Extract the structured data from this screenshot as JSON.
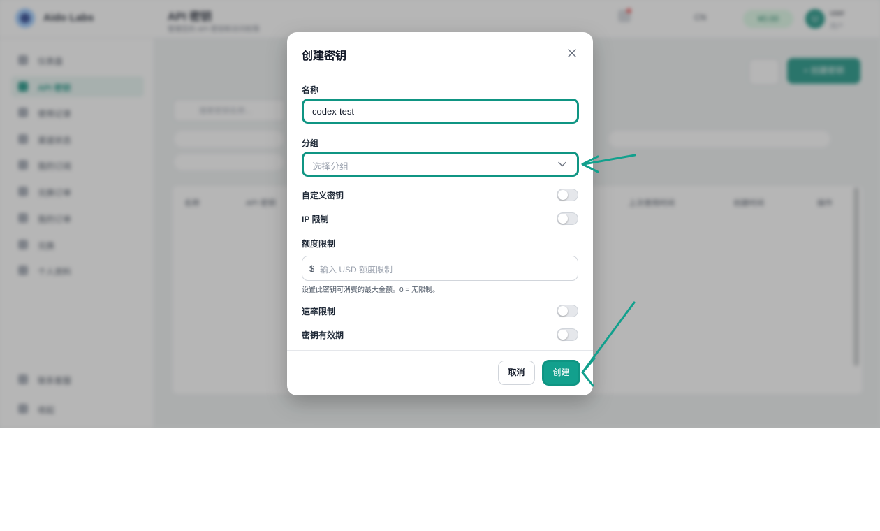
{
  "background": {
    "brand": "Aido Labs",
    "page_title": "API 密钥",
    "page_subtitle": "管理您的 API 密钥和访问权限",
    "header": {
      "lang": "CN",
      "balance": "¥0.00",
      "user_name": "user",
      "user_sub": "用户",
      "avatar_initial": "U"
    },
    "sidebar": [
      {
        "label": "仪表盘",
        "active": false
      },
      {
        "label": "API 密钥",
        "active": true
      },
      {
        "label": "使用记录",
        "active": false
      },
      {
        "label": "渠道状态",
        "active": false
      },
      {
        "label": "我的订阅",
        "active": false
      },
      {
        "label": "兑换订单",
        "active": false
      },
      {
        "label": "我的订单",
        "active": false
      },
      {
        "label": "兑换",
        "active": false
      },
      {
        "label": "个人资料",
        "active": false
      }
    ],
    "sidebar_bottom": [
      "联系客服",
      "收起"
    ],
    "create_key_label": "+ 创建密钥",
    "search_placeholder": "搜索密钥名称...",
    "table_headers": [
      "名称",
      "API 密钥",
      "上次使用时间",
      "创建时间",
      "操作"
    ]
  },
  "modal": {
    "title": "创建密钥",
    "name_label": "名称",
    "name_value": "codex-test",
    "group_label": "分组",
    "group_placeholder": "选择分组",
    "custom_key_label": "自定义密钥",
    "ip_limit_label": "IP 限制",
    "quota_label": "额度限制",
    "currency_symbol": "$",
    "quota_placeholder": "输入 USD 额度限制",
    "quota_help": "设置此密钥可消费的最大金额。0 = 无限制。",
    "rate_limit_label": "速率限制",
    "expiry_label": "密钥有效期",
    "cancel_label": "取消",
    "create_label": "创建"
  },
  "colors": {
    "accent": "#0f9583",
    "create_fill": "#12a08d",
    "annotation_arrow": "#12a08d"
  }
}
